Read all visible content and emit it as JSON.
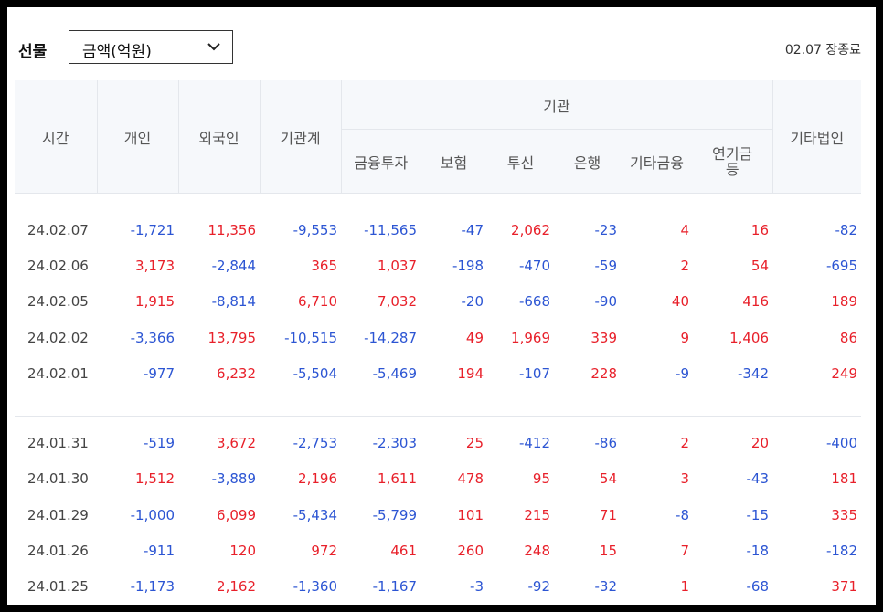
{
  "market_label": "선물",
  "unit_select": {
    "value": "금액(억원)"
  },
  "close_note": "02.07 장종료",
  "headers": {
    "time": "시간",
    "individual": "개인",
    "foreign": "외국인",
    "institution_total": "기관계",
    "institution_group": "기관",
    "financial_investment": "금융투자",
    "insurance": "보험",
    "investment_trust": "투신",
    "bank": "은행",
    "other_finance": "기타금융",
    "pension": "연기금\n등",
    "other_corp": "기타법인"
  },
  "rows_group1": [
    {
      "date": "24.02.07",
      "values": [
        "-1,721",
        "11,356",
        "-9,553",
        "-11,565",
        "-47",
        "2,062",
        "-23",
        "4",
        "16",
        "-82"
      ]
    },
    {
      "date": "24.02.06",
      "values": [
        "3,173",
        "-2,844",
        "365",
        "1,037",
        "-198",
        "-470",
        "-59",
        "2",
        "54",
        "-695"
      ]
    },
    {
      "date": "24.02.05",
      "values": [
        "1,915",
        "-8,814",
        "6,710",
        "7,032",
        "-20",
        "-668",
        "-90",
        "40",
        "416",
        "189"
      ]
    },
    {
      "date": "24.02.02",
      "values": [
        "-3,366",
        "13,795",
        "-10,515",
        "-14,287",
        "49",
        "1,969",
        "339",
        "9",
        "1,406",
        "86"
      ]
    },
    {
      "date": "24.02.01",
      "values": [
        "-977",
        "6,232",
        "-5,504",
        "-5,469",
        "194",
        "-107",
        "228",
        "-9",
        "-342",
        "249"
      ]
    }
  ],
  "rows_group2": [
    {
      "date": "24.01.31",
      "values": [
        "-519",
        "3,672",
        "-2,753",
        "-2,303",
        "25",
        "-412",
        "-86",
        "2",
        "20",
        "-400"
      ]
    },
    {
      "date": "24.01.30",
      "values": [
        "1,512",
        "-3,889",
        "2,196",
        "1,611",
        "478",
        "95",
        "54",
        "3",
        "-43",
        "181"
      ]
    },
    {
      "date": "24.01.29",
      "values": [
        "-1,000",
        "6,099",
        "-5,434",
        "-5,799",
        "101",
        "215",
        "71",
        "-8",
        "-15",
        "335"
      ]
    },
    {
      "date": "24.01.26",
      "values": [
        "-911",
        "120",
        "972",
        "461",
        "260",
        "248",
        "15",
        "7",
        "-18",
        "-182"
      ]
    },
    {
      "date": "24.01.25",
      "values": [
        "-1,173",
        "2,162",
        "-1,360",
        "-1,167",
        "-3",
        "-92",
        "-32",
        "1",
        "-68",
        "371"
      ]
    }
  ],
  "colors": {
    "positive": "#e8202a",
    "negative": "#2c55d3"
  }
}
